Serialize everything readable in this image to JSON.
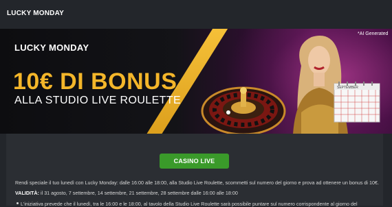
{
  "header": {
    "title": "LUCKY MONDAY"
  },
  "banner": {
    "brand": "LUCKY MONDAY",
    "headline": "10€ DI BONUS",
    "subheadline": "ALLA STUDIO LIVE ROULETTE",
    "ai_badge": "*AI Generated",
    "calendar_header": "SEPTEMBER",
    "accent_color": "#f4b62a"
  },
  "cta": {
    "label": "CASINO LIVE",
    "color": "#3a9a2a"
  },
  "body": {
    "intro": "Rendi speciale il tuo lunedì con Lucky Monday: dalle 16:00 alle 18:00, alla Studio Live Roulette, scommetti sul numero del giorno e prova ad ottenere un bonus di 10€.",
    "validity_label": "VALIDITÀ:",
    "validity_text": " il 31 agosto, 7 settembre, 14 settembre, 21 settembre, 28 settembre dalle 16:00 alle 18:00",
    "bullet_1": "L'iniziativa prevede che il lunedì, tra le 16:00 e le 18:00, al tavolo della Studio Live Roulette sarà possibile puntare sul numero corrispondente al giorno del"
  }
}
